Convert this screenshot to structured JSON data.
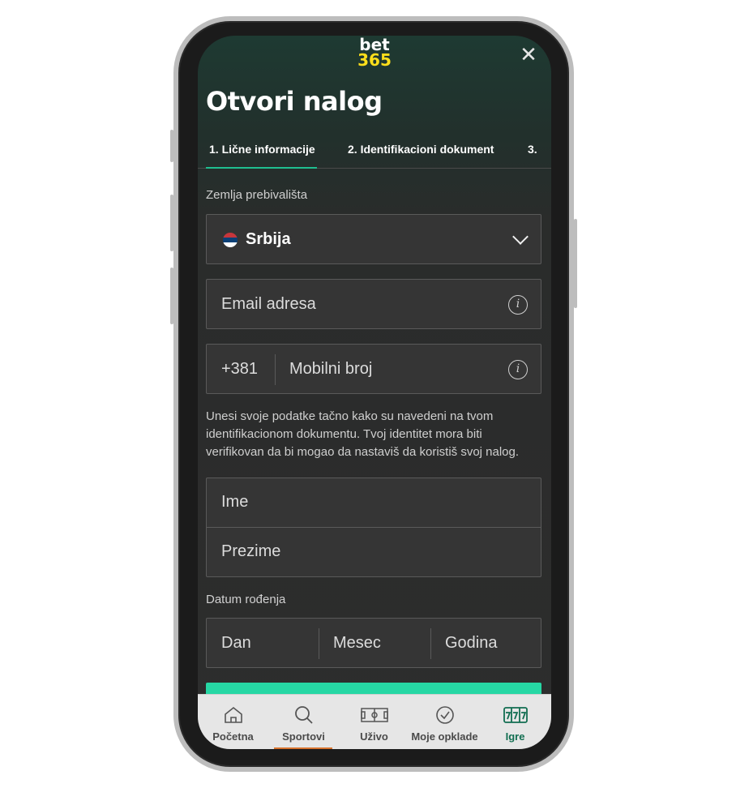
{
  "logo": {
    "line1": "bet",
    "line2": "365"
  },
  "close_symbol": "✕",
  "page_title": "Otvori nalog",
  "steps": [
    {
      "label": "1. Lične informacije",
      "active": true
    },
    {
      "label": "2. Identifikacioni dokument",
      "active": false
    },
    {
      "label": "3.",
      "active": false
    }
  ],
  "country": {
    "label": "Zemlja prebivališta",
    "value": "Srbija",
    "flag_icon": "serbia-flag-icon"
  },
  "email": {
    "placeholder": "Email adresa"
  },
  "phone": {
    "prefix": "+381",
    "placeholder": "Mobilni broj"
  },
  "info_symbol": "i",
  "note": "Unesi svoje podatke tačno kako su navedeni na tvom identifikacionom dokumentu. Tvoj identitet mora biti verifikovan da bi mogao da nastaviš da koristiš svoj nalog.",
  "name_fields": {
    "first": "Ime",
    "last": "Prezime"
  },
  "dob": {
    "label": "Datum rođenja",
    "day": "Dan",
    "month": "Mesec",
    "year": "Godina"
  },
  "tabbar": [
    {
      "label": "Početna",
      "icon": "home-icon"
    },
    {
      "label": "Sportovi",
      "icon": "search-icon"
    },
    {
      "label": "Uživo",
      "icon": "pitch-icon"
    },
    {
      "label": "Moje opklade",
      "icon": "check-circle-icon"
    },
    {
      "label": "Igre",
      "icon": "slots-icon"
    }
  ],
  "colors": {
    "accent": "#26d7a4",
    "brand_yellow": "#ffdf1b",
    "active_tab": "#126e51",
    "tab_indicator": "#d8732d"
  }
}
